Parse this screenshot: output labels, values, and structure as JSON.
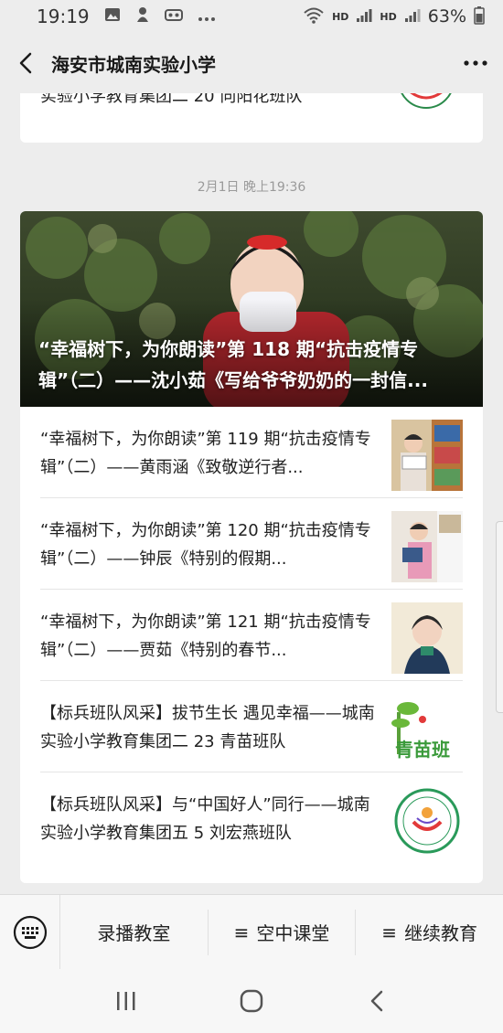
{
  "status_bar": {
    "time": "19:19",
    "net1": "HD",
    "net2": "HD",
    "battery": "63%",
    "icons": [
      "image-icon",
      "app-icon",
      "vr-icon",
      "more-dots-icon",
      "wifi-icon",
      "signal-icon",
      "signal-icon",
      "battery-icon"
    ]
  },
  "nav": {
    "title": "海安市城南实验小学"
  },
  "top_card": {
    "text": "实验小学教育集团二 20 向阳花班队"
  },
  "timestamp": "2月1日 晚上19:36",
  "hero": {
    "title": "“幸福树下，为你朗读”第 118 期“抗击疫情专辑”（二）——沈小茹《写给爷爷奶奶的一封信..."
  },
  "articles": [
    {
      "text": "“幸福树下，为你朗读”第 119 期“抗击疫情专辑”（二）——黄雨涵《致敬逆行者..."
    },
    {
      "text": "“幸福树下，为你朗读”第 120 期“抗击疫情专辑”（二）——钟辰《特别的假期..."
    },
    {
      "text": "“幸福树下，为你朗读”第 121 期“抗击疫情专辑”（二）——贾茹《特别的春节..."
    },
    {
      "text": "【标兵班队风采】拔节生长 遇见幸福——城南实验小学教育集团二 23 青苗班队",
      "thumb_label": "青苗班"
    },
    {
      "text": "【标兵班队风采】与“中国好人”同行——城南实验小学教育集团五 5 刘宏燕班队"
    }
  ],
  "bottom_menu": {
    "items": [
      {
        "label": "录播教室",
        "prefix": ""
      },
      {
        "label": "空中课堂",
        "prefix": "≡"
      },
      {
        "label": "继续教育",
        "prefix": "≡"
      }
    ]
  },
  "colors": {
    "background": "#ededed",
    "card": "#ffffff",
    "text": "#1a1a1a",
    "timestamp": "#9a9a9a"
  }
}
